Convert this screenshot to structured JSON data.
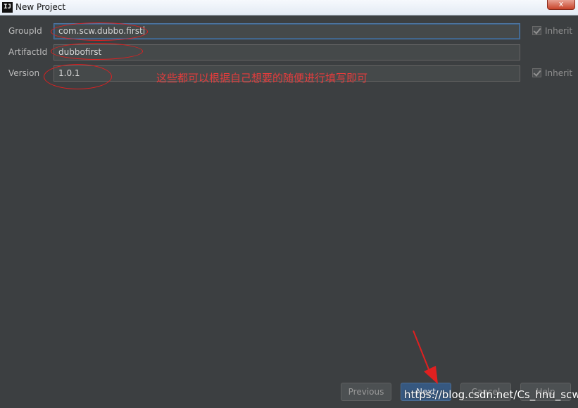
{
  "window": {
    "title": "New Project",
    "app_icon_text": "IJ",
    "close_symbol": "x"
  },
  "form": {
    "group_id": {
      "label": "GroupId",
      "value": "com.scw.dubbo.first",
      "inherit_label": "Inherit",
      "inherit_checked": true
    },
    "artifact_id": {
      "label": "ArtifactId",
      "value": "dubbofirst"
    },
    "version": {
      "label": "Version",
      "value": "1.0.1",
      "inherit_label": "Inherit",
      "inherit_checked": true
    }
  },
  "annotation": {
    "note": "这些都可以根据自己想要的随便进行填写即可",
    "color": "#e02020"
  },
  "buttons": {
    "previous": "Previous",
    "next": "Next",
    "cancel": "Cancel",
    "help": "Help"
  },
  "watermark": "https://blog.csdn.net/Cs_hnu_scw",
  "colors": {
    "background": "#3c3f41",
    "input_bg": "#45494a",
    "primary_button": "#365880"
  }
}
